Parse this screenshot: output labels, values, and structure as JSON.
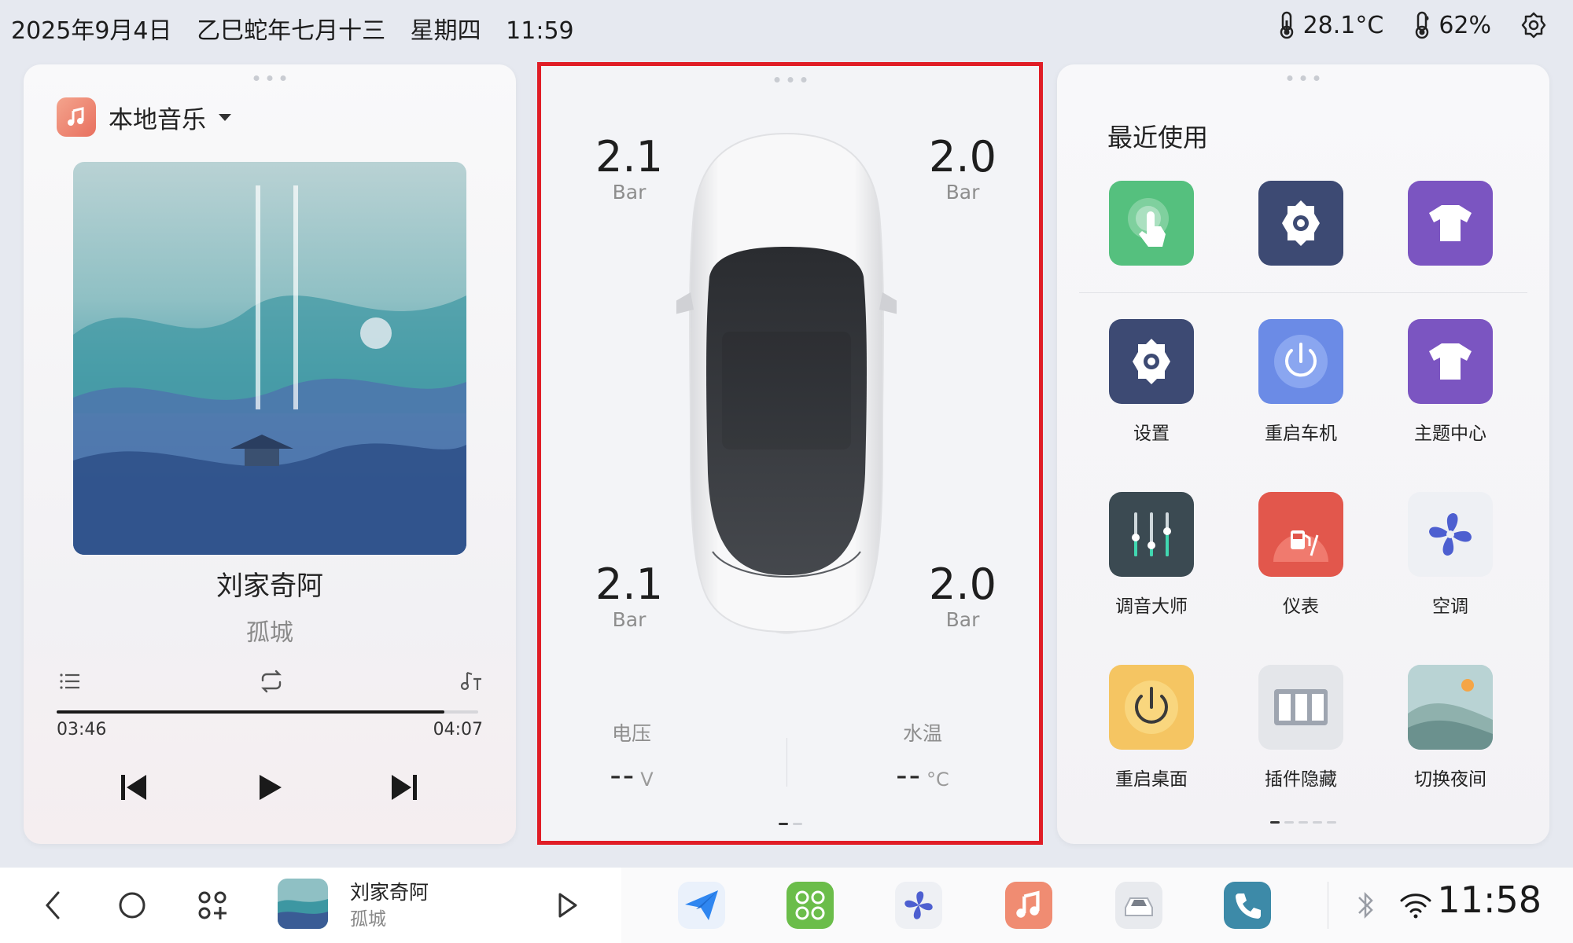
{
  "status": {
    "date": "2025年9月4日",
    "lunar": "乙巳蛇年七月十三",
    "weekday": "星期四",
    "time": "11:59",
    "temperature": "28.1°C",
    "humidity": "62%"
  },
  "music": {
    "source": "本地音乐",
    "artist": "刘家奇阿",
    "album": "孤城",
    "current_time": "03:46",
    "total_time": "04:07",
    "progress": 0.92
  },
  "car": {
    "tire_fl": "2.1",
    "tire_fr": "2.0",
    "tire_rl": "2.1",
    "tire_rr": "2.0",
    "tire_unit": "Bar",
    "voltage_label": "电压",
    "voltage_value": "--",
    "voltage_unit": "V",
    "water_label": "水温",
    "water_value": "--",
    "water_unit": "°C"
  },
  "apps": {
    "recent_title": "最近使用",
    "items": [
      {
        "label": "设置"
      },
      {
        "label": "重启车机"
      },
      {
        "label": "主题中心"
      },
      {
        "label": "调音大师"
      },
      {
        "label": "仪表"
      },
      {
        "label": "空调"
      },
      {
        "label": "重启桌面"
      },
      {
        "label": "插件隐藏"
      },
      {
        "label": "切换夜间"
      }
    ]
  },
  "dock": {
    "now_playing_title": "刘家奇阿",
    "now_playing_sub": "孤城",
    "time": "11:58"
  },
  "colors": {
    "highlight_border": "#e01d26",
    "green_app": "#55c07e",
    "settings_app": "#3d4a73",
    "theme_app": "#7b55c1",
    "power_app": "#6b8be6",
    "sound_app": "#3b4a52",
    "meter_app": "#e2574c",
    "desktop_app": "#f5c562"
  }
}
